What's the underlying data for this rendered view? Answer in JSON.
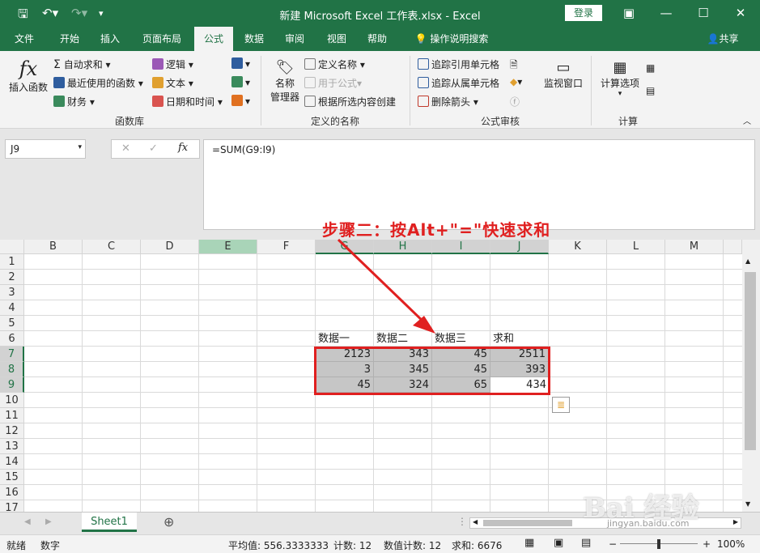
{
  "titlebar": {
    "title": "新建 Microsoft Excel 工作表.xlsx  -  Excel",
    "login": "登录"
  },
  "tabs": [
    "文件",
    "开始",
    "插入",
    "页面布局",
    "公式",
    "数据",
    "审阅",
    "视图",
    "帮助"
  ],
  "tell_me": "操作说明搜索",
  "share": "共享",
  "ribbon": {
    "insert_function": "插入函数",
    "autosum": "自动求和",
    "recent": "最近使用的函数",
    "financial": "财务",
    "logical": "逻辑",
    "text": "文本",
    "datetime": "日期和时间",
    "group_library": "函数库",
    "name_manager_1": "名称",
    "name_manager_2": "管理器",
    "define_name": "定义名称",
    "use_in_formula": "用于公式",
    "create_from_sel": "根据所选内容创建",
    "group_names": "定义的名称",
    "trace_precedents": "追踪引用单元格",
    "trace_dependents": "追踪从属单元格",
    "remove_arrows": "删除箭头",
    "group_auditing": "公式审核",
    "watch_window": "监视窗口",
    "calc_options": "计算选项",
    "group_calc": "计算"
  },
  "formula_bar": {
    "name_box": "J9",
    "formula": "=SUM(G9:I9)"
  },
  "columns": [
    "B",
    "C",
    "D",
    "E",
    "F",
    "G",
    "H",
    "I",
    "J",
    "K",
    "L",
    "M"
  ],
  "rows": [
    "1",
    "2",
    "3",
    "4",
    "5",
    "6",
    "7",
    "8",
    "9",
    "10",
    "11",
    "12",
    "13",
    "14",
    "15",
    "16",
    "17"
  ],
  "sheet": {
    "headers": [
      "数据一",
      "数据二",
      "数据三",
      "求和"
    ],
    "data": [
      [
        "2123",
        "343",
        "45",
        "2511"
      ],
      [
        "3",
        "345",
        "45",
        "393"
      ],
      [
        "45",
        "324",
        "65",
        "434"
      ]
    ]
  },
  "annotation": "步骤二：按Alt+\"=\"快速求和",
  "sheet_tab": "Sheet1",
  "status": {
    "ready": "就绪",
    "mode": "数字",
    "average": "平均值: 556.3333333",
    "count": "计数: 12",
    "numcount": "数值计数: 12",
    "sum": "求和: 6676",
    "zoom": "100%"
  },
  "watermark": "Bai 经验",
  "watermark_sub": "jingyan.baidu.com",
  "colors": {
    "excel_green": "#217346",
    "annotation_red": "#e02020"
  }
}
